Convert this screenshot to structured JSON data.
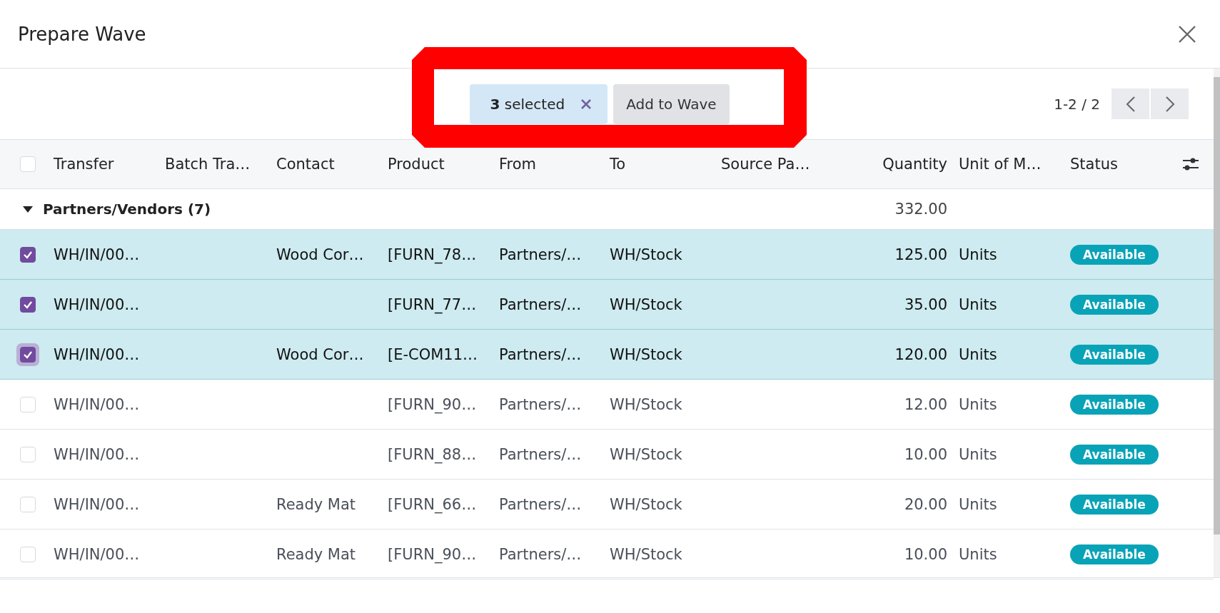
{
  "dialog": {
    "title": "Prepare Wave"
  },
  "selection": {
    "count_text": "**3** selected",
    "action": "Add to Wave"
  },
  "pager": {
    "range": "1-2 / 2"
  },
  "table": {
    "all_selected": false,
    "columns": [
      {
        "label": "Transfer",
        "kind": "text"
      },
      {
        "label": "Batch Tra…",
        "kind": "text"
      },
      {
        "label": "Contact",
        "kind": "text"
      },
      {
        "label": "Product",
        "kind": "text"
      },
      {
        "label": "From",
        "kind": "text"
      },
      {
        "label": "To",
        "kind": "text"
      },
      {
        "label": "Source Pa…",
        "kind": "text"
      },
      {
        "label": "Quantity",
        "kind": "number"
      },
      {
        "label": "Unit of M…",
        "kind": "text"
      },
      {
        "label": "Status",
        "kind": "text"
      }
    ],
    "groups": [
      {
        "name": "Partners/Vendors (7)",
        "expanded": true,
        "quantity_total": "332.00",
        "rows": [
          {
            "selected": true,
            "focused": false,
            "transfer": "WH/IN/00…",
            "contact": "Wood Cor…",
            "product": "[FURN_78…",
            "from": "Partners/…",
            "to": "WH/Stock",
            "quantity": "125.00",
            "unit": "Units",
            "status": "Available"
          },
          {
            "selected": true,
            "focused": false,
            "transfer": "WH/IN/00…",
            "product": "[FURN_77…",
            "from": "Partners/…",
            "to": "WH/Stock",
            "quantity": "35.00",
            "unit": "Units",
            "status": "Available"
          },
          {
            "selected": true,
            "focused": true,
            "transfer": "WH/IN/00…",
            "contact": "Wood Cor…",
            "product": "[E-COM11…",
            "from": "Partners/…",
            "to": "WH/Stock",
            "quantity": "120.00",
            "unit": "Units",
            "status": "Available"
          },
          {
            "selected": false,
            "focused": false,
            "transfer": "WH/IN/00…",
            "product": "[FURN_90…",
            "from": "Partners/…",
            "to": "WH/Stock",
            "quantity": "12.00",
            "unit": "Units",
            "status": "Available"
          },
          {
            "selected": false,
            "focused": false,
            "transfer": "WH/IN/00…",
            "product": "[FURN_88…",
            "from": "Partners/…",
            "to": "WH/Stock",
            "quantity": "10.00",
            "unit": "Units",
            "status": "Available"
          },
          {
            "selected": false,
            "focused": false,
            "transfer": "WH/IN/00…",
            "contact": "Ready Mat",
            "product": "[FURN_66…",
            "from": "Partners/…",
            "to": "WH/Stock",
            "quantity": "20.00",
            "unit": "Units",
            "status": "Available"
          },
          {
            "selected": false,
            "focused": false,
            "transfer": "WH/IN/00…",
            "contact": "Ready Mat",
            "product": "[FURN_90…",
            "from": "Partners/…",
            "to": "WH/Stock",
            "quantity": "10.00",
            "unit": "Units",
            "status": "Available"
          }
        ]
      }
    ]
  }
}
